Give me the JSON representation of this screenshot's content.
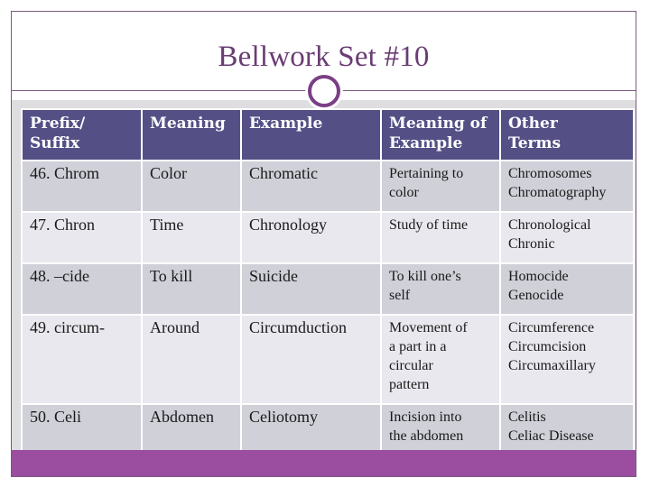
{
  "title": "Bellwork Set #10",
  "colors": {
    "title": "#6a3d74",
    "header_bg": "#545086",
    "row_odd": "#cfd0d8",
    "row_even": "#e8e8ee",
    "footer": "#9b4ea0",
    "ring": "#7b3f86"
  },
  "table": {
    "headers": [
      [
        "Prefix/",
        "Suffix"
      ],
      [
        "Meaning"
      ],
      [
        "Example"
      ],
      [
        "Meaning of",
        "Example"
      ],
      [
        "Other",
        "Terms"
      ]
    ],
    "rows": [
      {
        "prefix": "46. Chrom",
        "meaning": "Color",
        "example": "Chromatic",
        "example_meaning": [
          "Pertaining to",
          "color"
        ],
        "other_terms": [
          "Chromosomes",
          "Chromatography"
        ]
      },
      {
        "prefix": "47. Chron",
        "meaning": "Time",
        "example": "Chronology",
        "example_meaning": [
          "Study of time"
        ],
        "other_terms": [
          "Chronological",
          "Chronic"
        ]
      },
      {
        "prefix": "48. –cide",
        "meaning": "To kill",
        "example": "Suicide",
        "example_meaning": [
          "To kill one’s",
          "self"
        ],
        "other_terms": [
          "Homocide",
          "Genocide"
        ]
      },
      {
        "prefix": "49. circum-",
        "meaning": "Around",
        "example": "Circumduction",
        "example_meaning": [
          "Movement of",
          "a part in a",
          "circular",
          "pattern"
        ],
        "other_terms": [
          "Circumference",
          "Circumcision",
          "Circumaxillary"
        ]
      },
      {
        "prefix": "50. Celi",
        "meaning": "Abdomen",
        "example": "Celiotomy",
        "example_meaning": [
          "Incision into",
          "the abdomen"
        ],
        "other_terms": [
          "Celitis",
          "Celiac Disease"
        ]
      }
    ]
  }
}
